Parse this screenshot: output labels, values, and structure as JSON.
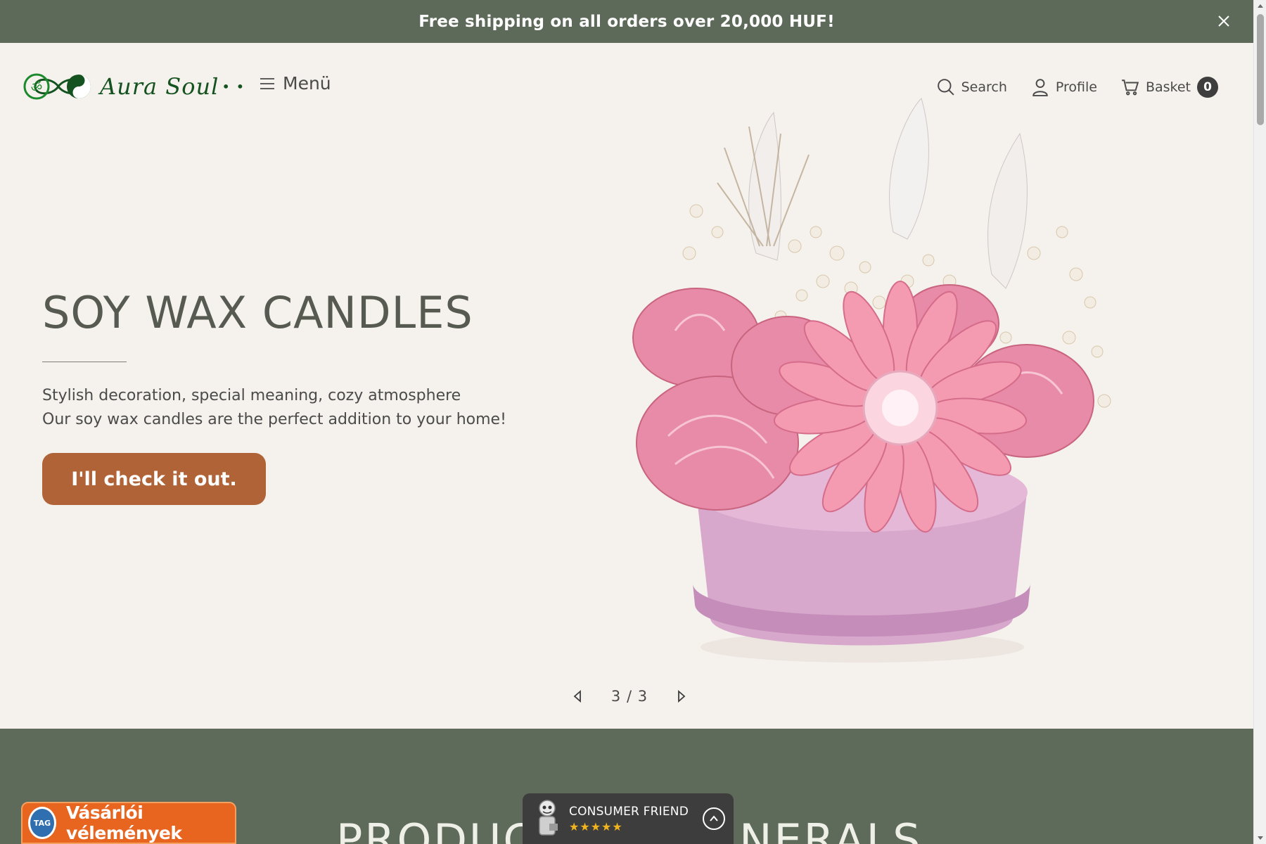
{
  "announcement": {
    "text": "Free shipping on all orders over 20,000 HUF!"
  },
  "header": {
    "logo_text": "Aura Soul",
    "menu_label": "Menü",
    "search_label": "Search",
    "profile_label": "Profile",
    "basket_label": "Basket",
    "basket_count": "0"
  },
  "hero": {
    "title": "SOY WAX CANDLES",
    "subtitle_line1": "Stylish decoration, special meaning, cozy atmosphere",
    "subtitle_line2": "Our soy wax candles are the perfect addition to your home!",
    "cta_label": "I'll check it out.",
    "slide_counter": "3 / 3"
  },
  "section2": {
    "title": "PRODUCTS BY MINERALS"
  },
  "widgets": {
    "reviews_label": "Vásárlói vélemények",
    "reviews_seal": "TAG",
    "consumer_friend_label": "CONSUMER FRIEND",
    "consumer_friend_stars": "★★★★★"
  },
  "colors": {
    "announce_bg": "#5e6a59",
    "page_bg": "#f5f1ec",
    "cta_bg": "#b06337",
    "section_bg": "#5f6b5a",
    "review_widget_bg": "#e8651f"
  }
}
